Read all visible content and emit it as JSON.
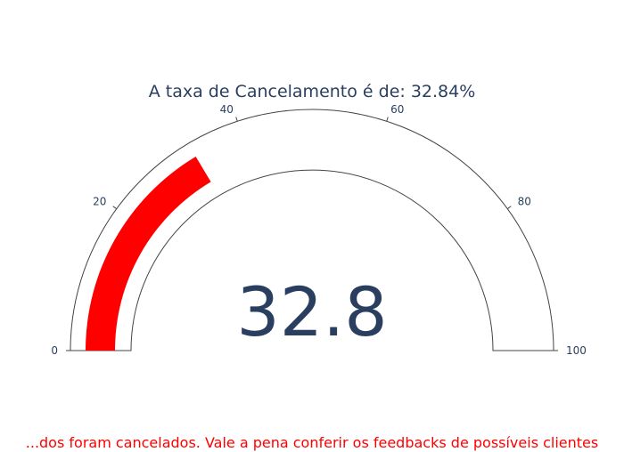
{
  "chart_data": {
    "type": "gauge",
    "title": "A taxa de Cancelamento é de: 32.84%",
    "value": 32.84,
    "value_display": "32.8",
    "range": [
      0,
      100
    ],
    "ticks": [
      0,
      20,
      40,
      60,
      80,
      100
    ],
    "tick_labels": [
      "0",
      "20",
      "40",
      "60",
      "80",
      "100"
    ],
    "bar_color": "#ff0000",
    "text_color": "#2a3f5f",
    "outline_color": "#444444"
  },
  "footer_note": "...dos foram cancelados. Vale a pena conferir os feedbacks de possíveis clientes"
}
